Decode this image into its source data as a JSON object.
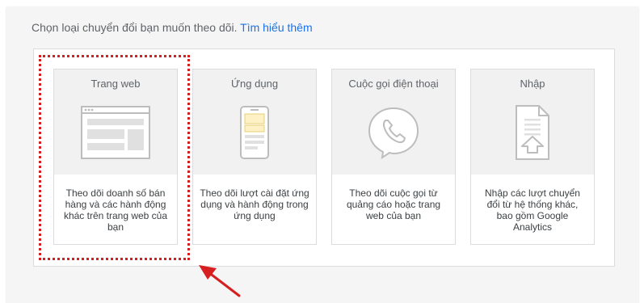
{
  "header": {
    "prompt_text": "Chọn loại chuyển đổi bạn muốn theo dõi.",
    "learn_more_link": "Tìm hiểu thêm"
  },
  "cards": [
    {
      "title": "Trang web",
      "description": "Theo dõi doanh số bán hàng và các hành động khác trên trang web của bạn",
      "icon": "website-icon"
    },
    {
      "title": "Ứng dụng",
      "description": "Theo dõi lượt cài đặt ứng dụng và hành động trong ứng dụng",
      "icon": "mobile-app-icon"
    },
    {
      "title": "Cuộc gọi điện thoại",
      "description": "Theo dõi cuộc gọi từ quảng cáo hoặc trang web của bạn",
      "icon": "phone-call-icon"
    },
    {
      "title": "Nhập",
      "description": "Nhập các lượt chuyển đổi từ hệ thống khác, bao gồm Google Analytics",
      "icon": "import-file-icon"
    }
  ],
  "annotation": {
    "highlight_color": "#d61f1f",
    "highlighted_card": "Trang web",
    "arrow_icon": "red-arrow-icon"
  }
}
